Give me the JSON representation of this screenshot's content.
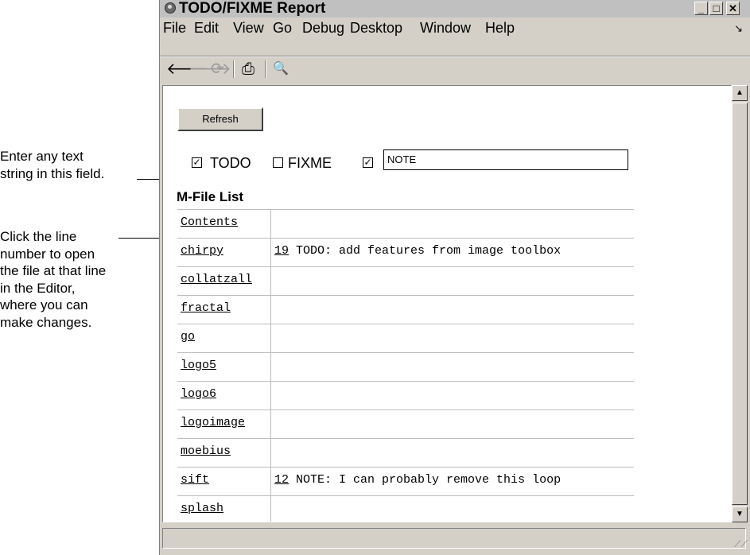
{
  "annotations": {
    "field_note": "Enter any text\nstring in this field.",
    "line_note": "Click the line\nnumber to open\nthe file at that line\nin the Editor,\nwhere you can\nmake changes."
  },
  "window": {
    "title": "TODO/FIXME Report",
    "controls": {
      "minimize": "_",
      "maximize": "□",
      "close": "✕"
    }
  },
  "menu": {
    "items": [
      "File",
      "Edit",
      "View",
      "Go",
      "Debug",
      "Desktop",
      "Window",
      "Help"
    ]
  },
  "toolbar": {
    "back": "🡐",
    "forward": "🡒",
    "refresh": "⟳",
    "print": "⎙",
    "find": "🔍"
  },
  "content": {
    "refresh_label": "Refresh",
    "filters": [
      {
        "label": "TODO",
        "checked": true
      },
      {
        "label": "FIXME",
        "checked": false
      },
      {
        "label": "",
        "checked": true
      }
    ],
    "note_input_value": "NOTE",
    "section_title": "M-File List",
    "files": [
      {
        "name": "Contents",
        "line": "",
        "comment": ""
      },
      {
        "name": "chirpy",
        "line": "19",
        "comment": " TODO: add features from image toolbox"
      },
      {
        "name": "collatzall",
        "line": "",
        "comment": ""
      },
      {
        "name": "fractal",
        "line": "",
        "comment": ""
      },
      {
        "name": "go",
        "line": "",
        "comment": ""
      },
      {
        "name": "logo5",
        "line": "",
        "comment": ""
      },
      {
        "name": "logo6",
        "line": "",
        "comment": ""
      },
      {
        "name": "logoimage",
        "line": "",
        "comment": ""
      },
      {
        "name": "moebius",
        "line": "",
        "comment": ""
      },
      {
        "name": "sift",
        "line": "12",
        "comment": " NOTE: I can probably remove this loop"
      },
      {
        "name": "splash",
        "line": "",
        "comment": ""
      }
    ]
  }
}
